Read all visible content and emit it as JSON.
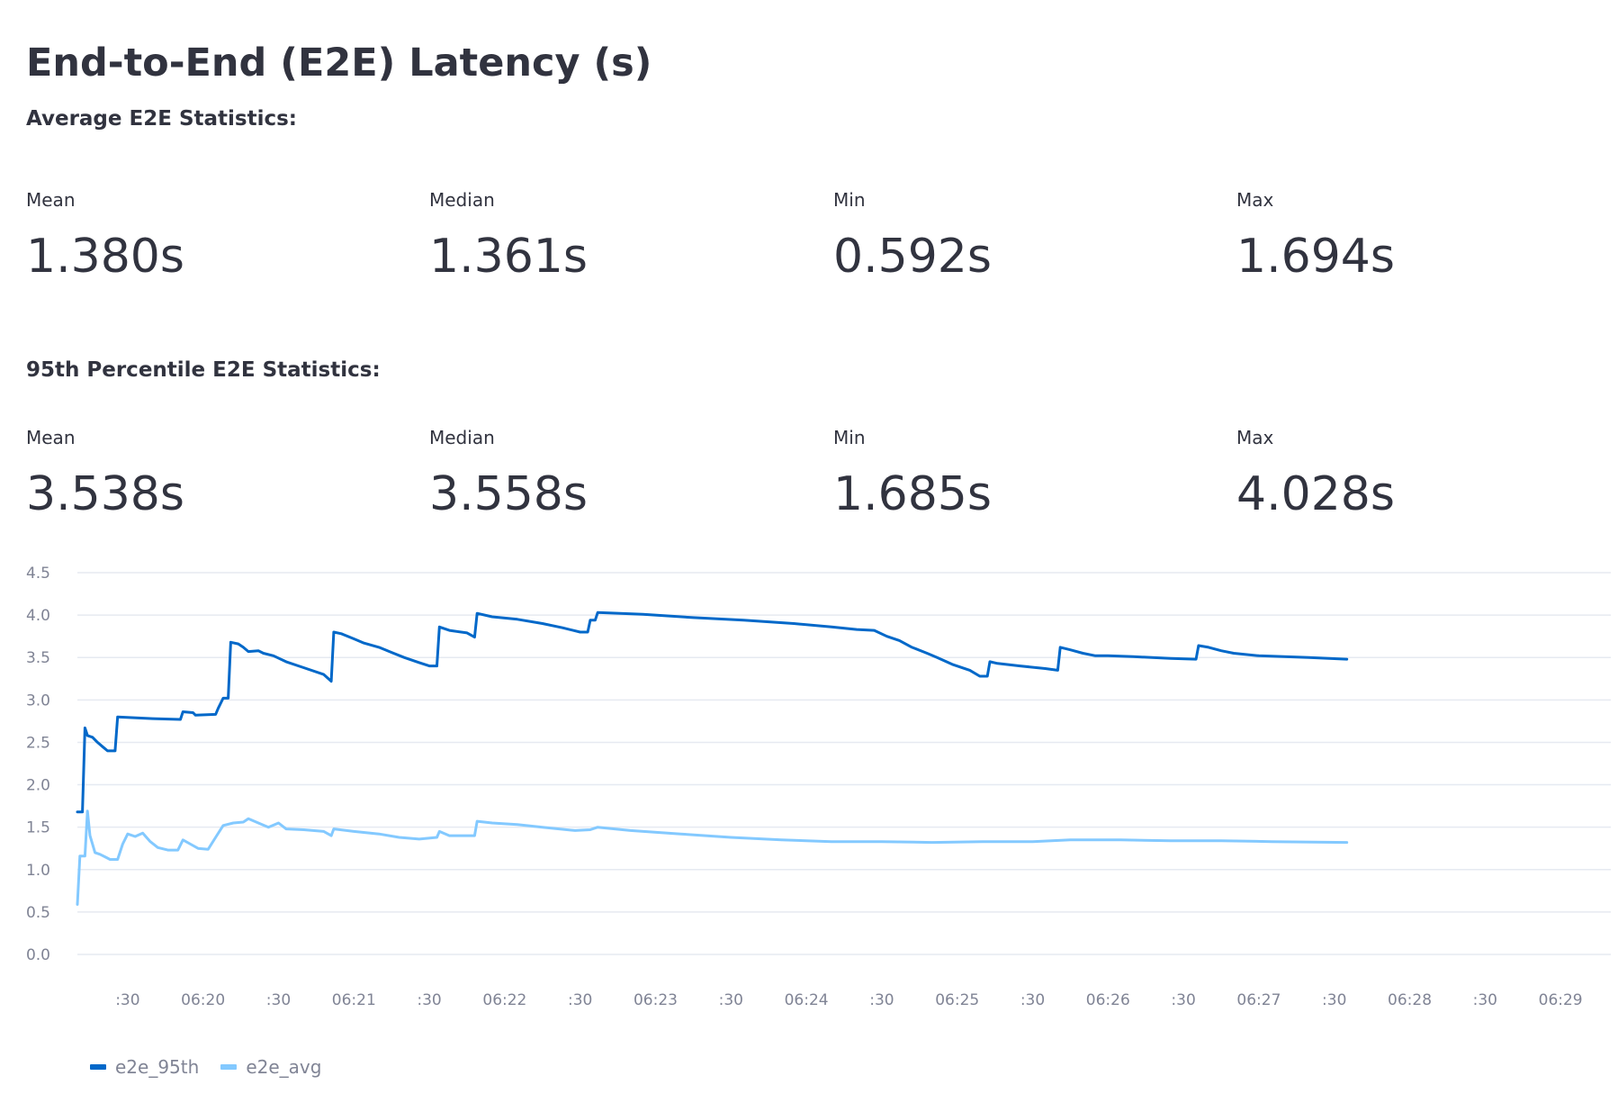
{
  "title": "End-to-End (E2E) Latency (s)",
  "avg_section": {
    "heading": "Average E2E Statistics:",
    "metrics": [
      {
        "label": "Mean",
        "value": "1.380s"
      },
      {
        "label": "Median",
        "value": "1.361s"
      },
      {
        "label": "Min",
        "value": "0.592s"
      },
      {
        "label": "Max",
        "value": "1.694s"
      }
    ]
  },
  "p95_section": {
    "heading": "95th Percentile E2E Statistics:",
    "metrics": [
      {
        "label": "Mean",
        "value": "3.538s"
      },
      {
        "label": "Median",
        "value": "3.558s"
      },
      {
        "label": "Min",
        "value": "1.685s"
      },
      {
        "label": "Max",
        "value": "4.028s"
      }
    ]
  },
  "colors": {
    "e2e_95th": "#0068c9",
    "e2e_avg": "#83c9ff",
    "text": "#31333f",
    "axis_text": "#808495",
    "grid": "#e6eaf1"
  },
  "chart_data": {
    "type": "line",
    "title": "",
    "xlabel": "",
    "ylabel": "",
    "ylim": [
      0,
      4.5
    ],
    "yticks": [
      0.0,
      0.5,
      1.0,
      1.5,
      2.0,
      2.5,
      3.0,
      3.5,
      4.0,
      4.5
    ],
    "ytick_labels": [
      "0.0",
      "0.5",
      "1.0",
      "1.5",
      "2.0",
      "2.5",
      "3.0",
      "3.5",
      "4.0",
      "4.5"
    ],
    "x_unit": "time",
    "xlim": [
      "06:19:10",
      "06:29:20"
    ],
    "xticks": [
      "06:19:30",
      "06:20:00",
      "06:20:30",
      "06:21:00",
      "06:21:30",
      "06:22:00",
      "06:22:30",
      "06:23:00",
      "06:23:30",
      "06:24:00",
      "06:24:30",
      "06:25:00",
      "06:25:30",
      "06:26:00",
      "06:26:30",
      "06:27:00",
      "06:27:30",
      "06:28:00",
      "06:28:30",
      "06:29:00"
    ],
    "xtick_labels": [
      ":30",
      "06:20",
      ":30",
      "06:21",
      ":30",
      "06:22",
      ":30",
      "06:23",
      ":30",
      "06:24",
      ":30",
      "06:25",
      ":30",
      "06:26",
      ":30",
      "06:27",
      ":30",
      "06:28",
      ":30",
      "06:29"
    ],
    "grid": true,
    "legend_position": "bottom-left",
    "series": [
      {
        "name": "e2e_95th",
        "color": "#0068c9",
        "points": [
          [
            "06:19:10",
            1.68
          ],
          [
            "06:19:12",
            1.68
          ],
          [
            "06:19:13",
            2.67
          ],
          [
            "06:19:14",
            2.58
          ],
          [
            "06:19:16",
            2.56
          ],
          [
            "06:19:18",
            2.5
          ],
          [
            "06:19:20",
            2.45
          ],
          [
            "06:19:22",
            2.4
          ],
          [
            "06:19:25",
            2.4
          ],
          [
            "06:19:26",
            2.8
          ],
          [
            "06:19:40",
            2.78
          ],
          [
            "06:19:51",
            2.77
          ],
          [
            "06:19:52",
            2.86
          ],
          [
            "06:19:56",
            2.85
          ],
          [
            "06:19:57",
            2.82
          ],
          [
            "06:20:05",
            2.83
          ],
          [
            "06:20:06",
            2.9
          ],
          [
            "06:20:08",
            3.02
          ],
          [
            "06:20:10",
            3.02
          ],
          [
            "06:20:11",
            3.68
          ],
          [
            "06:20:14",
            3.66
          ],
          [
            "06:20:16",
            3.62
          ],
          [
            "06:20:18",
            3.57
          ],
          [
            "06:20:22",
            3.58
          ],
          [
            "06:20:24",
            3.55
          ],
          [
            "06:20:28",
            3.52
          ],
          [
            "06:20:33",
            3.45
          ],
          [
            "06:20:40",
            3.38
          ],
          [
            "06:20:48",
            3.3
          ],
          [
            "06:20:51",
            3.22
          ],
          [
            "06:20:52",
            3.8
          ],
          [
            "06:20:55",
            3.78
          ],
          [
            "06:21:00",
            3.72
          ],
          [
            "06:21:04",
            3.67
          ],
          [
            "06:21:10",
            3.62
          ],
          [
            "06:21:15",
            3.56
          ],
          [
            "06:21:20",
            3.5
          ],
          [
            "06:21:26",
            3.44
          ],
          [
            "06:21:30",
            3.4
          ],
          [
            "06:21:33",
            3.4
          ],
          [
            "06:21:34",
            3.86
          ],
          [
            "06:21:38",
            3.82
          ],
          [
            "06:21:45",
            3.79
          ],
          [
            "06:21:48",
            3.74
          ],
          [
            "06:21:49",
            4.02
          ],
          [
            "06:21:55",
            3.98
          ],
          [
            "06:22:05",
            3.95
          ],
          [
            "06:22:15",
            3.9
          ],
          [
            "06:22:23",
            3.85
          ],
          [
            "06:22:30",
            3.8
          ],
          [
            "06:22:33",
            3.8
          ],
          [
            "06:22:34",
            3.94
          ],
          [
            "06:22:36",
            3.94
          ],
          [
            "06:22:37",
            4.03
          ],
          [
            "06:22:55",
            4.01
          ],
          [
            "06:23:15",
            3.97
          ],
          [
            "06:23:35",
            3.94
          ],
          [
            "06:23:55",
            3.9
          ],
          [
            "06:24:10",
            3.86
          ],
          [
            "06:24:20",
            3.83
          ],
          [
            "06:24:27",
            3.82
          ],
          [
            "06:24:32",
            3.75
          ],
          [
            "06:24:37",
            3.7
          ],
          [
            "06:24:42",
            3.62
          ],
          [
            "06:24:48",
            3.55
          ],
          [
            "06:24:52",
            3.5
          ],
          [
            "06:24:58",
            3.42
          ],
          [
            "06:25:05",
            3.35
          ],
          [
            "06:25:09",
            3.28
          ],
          [
            "06:25:12",
            3.28
          ],
          [
            "06:25:13",
            3.45
          ],
          [
            "06:25:16",
            3.43
          ],
          [
            "06:25:25",
            3.4
          ],
          [
            "06:25:35",
            3.37
          ],
          [
            "06:25:40",
            3.35
          ],
          [
            "06:25:41",
            3.62
          ],
          [
            "06:25:45",
            3.59
          ],
          [
            "06:25:50",
            3.55
          ],
          [
            "06:25:55",
            3.52
          ],
          [
            "06:26:00",
            3.52
          ],
          [
            "06:26:10",
            3.51
          ],
          [
            "06:26:25",
            3.49
          ],
          [
            "06:26:35",
            3.48
          ],
          [
            "06:26:36",
            3.64
          ],
          [
            "06:26:40",
            3.62
          ],
          [
            "06:26:45",
            3.58
          ],
          [
            "06:26:50",
            3.55
          ],
          [
            "06:27:00",
            3.52
          ],
          [
            "06:27:20",
            3.5
          ],
          [
            "06:27:35",
            3.48
          ]
        ]
      },
      {
        "name": "e2e_avg",
        "color": "#83c9ff",
        "points": [
          [
            "06:19:10",
            0.59
          ],
          [
            "06:19:11",
            1.16
          ],
          [
            "06:19:13",
            1.16
          ],
          [
            "06:19:14",
            1.69
          ],
          [
            "06:19:15",
            1.4
          ],
          [
            "06:19:17",
            1.2
          ],
          [
            "06:19:19",
            1.18
          ],
          [
            "06:19:21",
            1.15
          ],
          [
            "06:19:23",
            1.12
          ],
          [
            "06:19:26",
            1.12
          ],
          [
            "06:19:28",
            1.3
          ],
          [
            "06:19:30",
            1.42
          ],
          [
            "06:19:33",
            1.39
          ],
          [
            "06:19:36",
            1.43
          ],
          [
            "06:19:39",
            1.33
          ],
          [
            "06:19:42",
            1.26
          ],
          [
            "06:19:46",
            1.23
          ],
          [
            "06:19:50",
            1.23
          ],
          [
            "06:19:52",
            1.35
          ],
          [
            "06:19:55",
            1.3
          ],
          [
            "06:19:58",
            1.25
          ],
          [
            "06:20:02",
            1.24
          ],
          [
            "06:20:05",
            1.38
          ],
          [
            "06:20:08",
            1.52
          ],
          [
            "06:20:12",
            1.55
          ],
          [
            "06:20:16",
            1.56
          ],
          [
            "06:20:18",
            1.6
          ],
          [
            "06:20:22",
            1.55
          ],
          [
            "06:20:26",
            1.5
          ],
          [
            "06:20:30",
            1.55
          ],
          [
            "06:20:33",
            1.48
          ],
          [
            "06:20:40",
            1.47
          ],
          [
            "06:20:48",
            1.45
          ],
          [
            "06:20:51",
            1.4
          ],
          [
            "06:20:52",
            1.48
          ],
          [
            "06:21:00",
            1.45
          ],
          [
            "06:21:10",
            1.42
          ],
          [
            "06:21:18",
            1.38
          ],
          [
            "06:21:26",
            1.36
          ],
          [
            "06:21:33",
            1.38
          ],
          [
            "06:21:34",
            1.45
          ],
          [
            "06:21:38",
            1.4
          ],
          [
            "06:21:48",
            1.4
          ],
          [
            "06:21:49",
            1.57
          ],
          [
            "06:21:55",
            1.55
          ],
          [
            "06:22:05",
            1.53
          ],
          [
            "06:22:15",
            1.5
          ],
          [
            "06:22:28",
            1.46
          ],
          [
            "06:22:34",
            1.47
          ],
          [
            "06:22:37",
            1.5
          ],
          [
            "06:22:50",
            1.46
          ],
          [
            "06:23:10",
            1.42
          ],
          [
            "06:23:30",
            1.38
          ],
          [
            "06:23:50",
            1.35
          ],
          [
            "06:24:10",
            1.33
          ],
          [
            "06:24:30",
            1.33
          ],
          [
            "06:24:50",
            1.32
          ],
          [
            "06:25:10",
            1.33
          ],
          [
            "06:25:30",
            1.33
          ],
          [
            "06:25:45",
            1.35
          ],
          [
            "06:26:05",
            1.35
          ],
          [
            "06:26:25",
            1.34
          ],
          [
            "06:26:45",
            1.34
          ],
          [
            "06:27:05",
            1.33
          ],
          [
            "06:27:35",
            1.32
          ]
        ]
      }
    ]
  }
}
